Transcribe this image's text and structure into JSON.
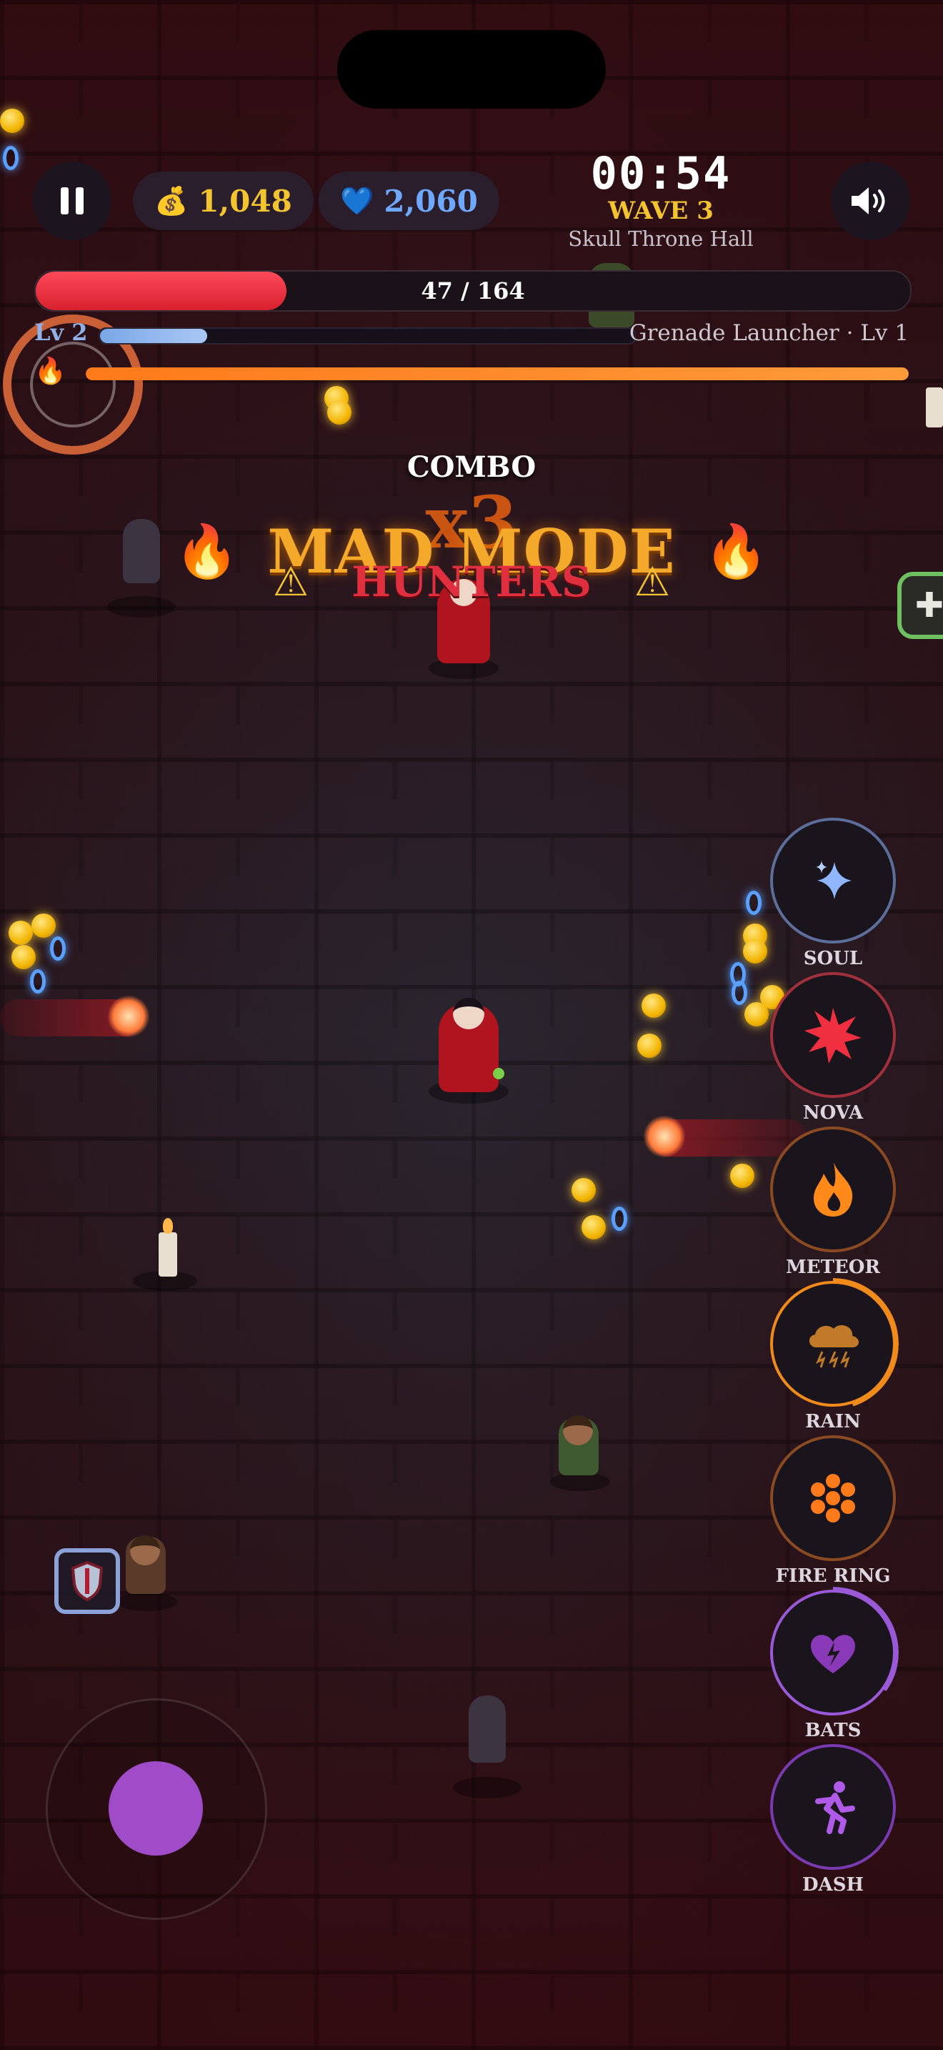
{
  "hud": {
    "gold": "1,048",
    "gems": "2,060",
    "timer": "00:54",
    "wave": "WAVE 3",
    "stage": "Skull Throne Hall",
    "hp": {
      "text": "47 / 164",
      "fraction": 0.287
    },
    "level": "Lv 2",
    "xp_fraction": 0.2,
    "weapon": "Grenade Launcher · Lv 1",
    "mad_meter_fraction": 1.0
  },
  "icons": {
    "pause": "pause-icon",
    "gold": "money-bag-icon",
    "gem": "blue-heart-icon",
    "sound": "speaker-icon",
    "fire": "fire-icon",
    "warning": "warning-icon",
    "heal": "plus-icon",
    "shield": "shield-icon"
  },
  "banner": {
    "combo": "COMBO",
    "multiplier": "x3",
    "mad_mode": "MAD MODE",
    "hunters": "HUNTERS"
  },
  "skills": [
    {
      "id": "soul",
      "label": "SOUL",
      "icon": "sparkle-icon",
      "ring": "#5c6e9a",
      "cooldown": 0
    },
    {
      "id": "nova",
      "label": "NOVA",
      "icon": "burst-icon",
      "ring": "#a0303c",
      "cooldown": 0
    },
    {
      "id": "meteor",
      "label": "METEOR",
      "icon": "flame-icon",
      "ring": "#8a4a22",
      "cooldown": 0
    },
    {
      "id": "rain",
      "label": "RAIN",
      "icon": "storm-cloud-icon",
      "ring": "#f08a1a",
      "cooldown": 0.45
    },
    {
      "id": "fire_ring",
      "label": "FIRE RING",
      "icon": "fire-ring-icon",
      "ring": "#8a4a22",
      "cooldown": 0
    },
    {
      "id": "bats",
      "label": "BATS",
      "icon": "bat-heart-icon",
      "ring": "#9a5ad8",
      "cooldown": 0.35
    },
    {
      "id": "dash",
      "label": "DASH",
      "icon": "running-icon",
      "ring": "#7a3ab0",
      "cooldown": 0
    }
  ],
  "colors": {
    "gold_text": "#f4c430",
    "gem_text": "#6fa8ff",
    "hp": "#e8283a",
    "xp": "#8fb0e8",
    "mad": "#ff8a24",
    "joystick_knob": "#a04cc8"
  }
}
